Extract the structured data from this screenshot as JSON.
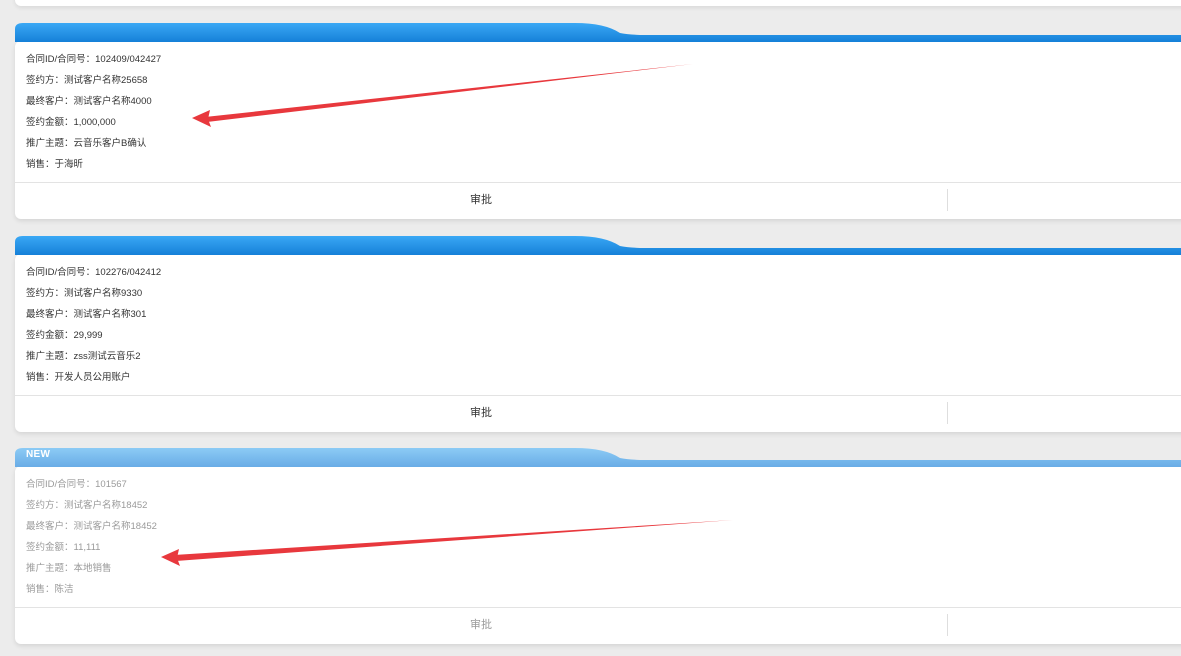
{
  "cards": [
    {
      "new_badge": "",
      "fields": [
        "合同ID/合同号：102409/042427",
        "签约方：测试客户名称25658",
        "最终客户：测试客户名称4000",
        "签约金额：1,000,000",
        "推广主题：云音乐客户B确认",
        "销售：于海昕"
      ],
      "approve_label": "审批"
    },
    {
      "new_badge": "",
      "fields": [
        "合同ID/合同号：102276/042412",
        "签约方：测试客户名称9330",
        "最终客户：测试客户名称301",
        "签约金额：29,999",
        "推广主题：zss测试云音乐2",
        "销售：开发人员公用账户"
      ],
      "approve_label": "审批"
    },
    {
      "new_badge": "NEW",
      "fields": [
        "合同ID/合同号：101567",
        "签约方：测试客户名称18452",
        "最终客户：测试客户名称18452",
        "签约金额：11,111",
        "推广主题：本地销售",
        "销售：陈洁"
      ],
      "approve_label": "审批"
    }
  ],
  "colors": {
    "header_blue": "#1a8fe3",
    "header_blue_faded": "#7bbdf0",
    "arrow_red": "#e8383d"
  }
}
